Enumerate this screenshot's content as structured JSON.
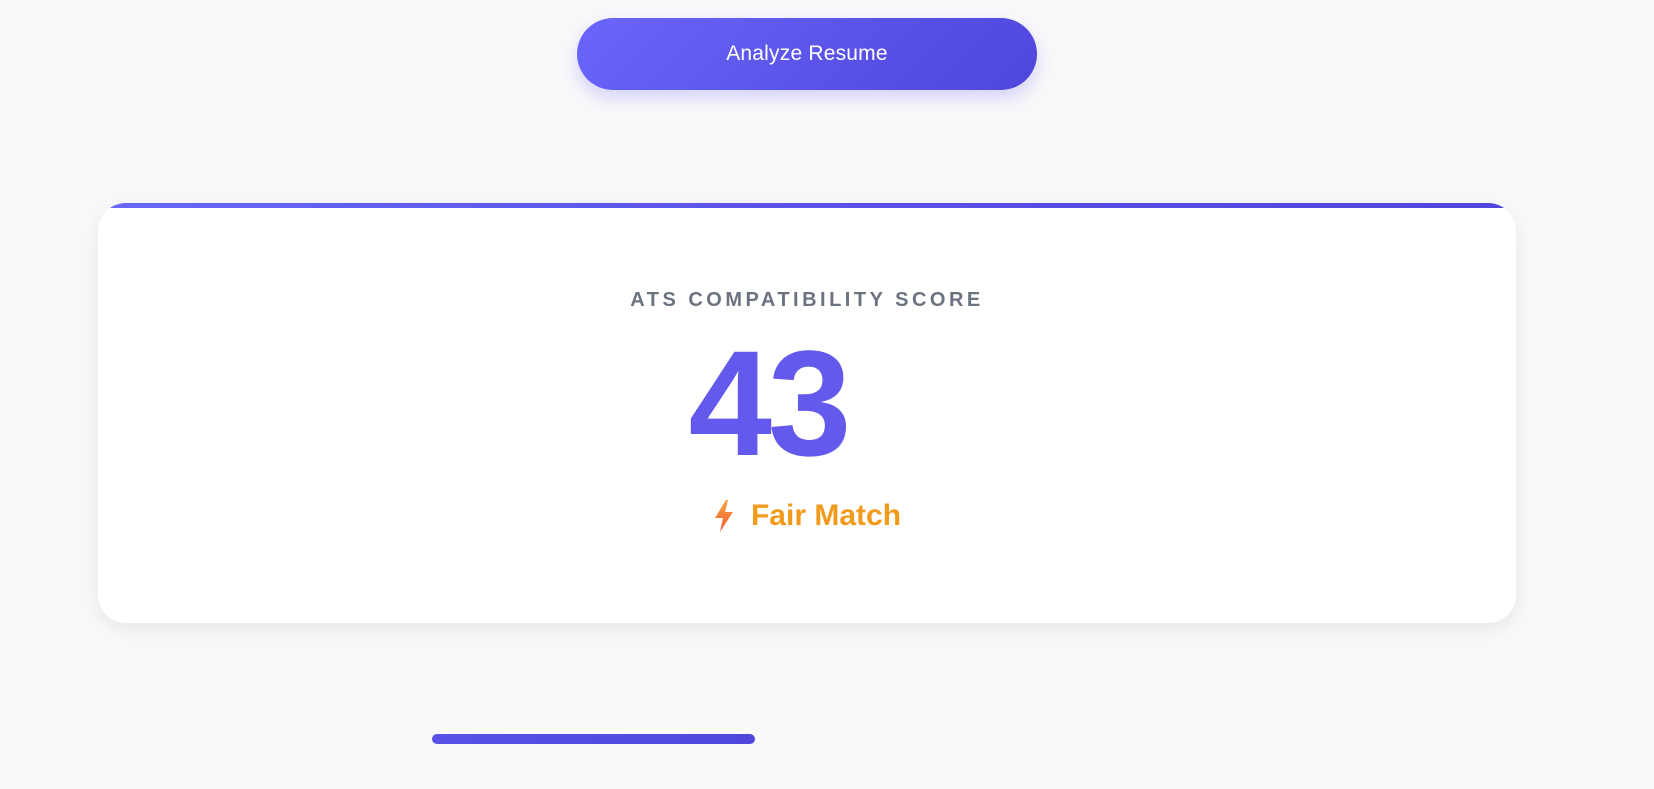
{
  "toolbar": {
    "analyze_label": "Analyze Resume"
  },
  "score_card": {
    "label": "ATS COMPATIBILITY SCORE",
    "score": "43",
    "match_label": "Fair Match",
    "match_icon": "lightning-bolt-icon"
  },
  "loading_bar": {
    "fill_fraction": 1.0
  },
  "colors": {
    "accent": "#6359ec",
    "match": "#f29a1b",
    "label": "#6b7280",
    "background": "#f9f9fa"
  }
}
